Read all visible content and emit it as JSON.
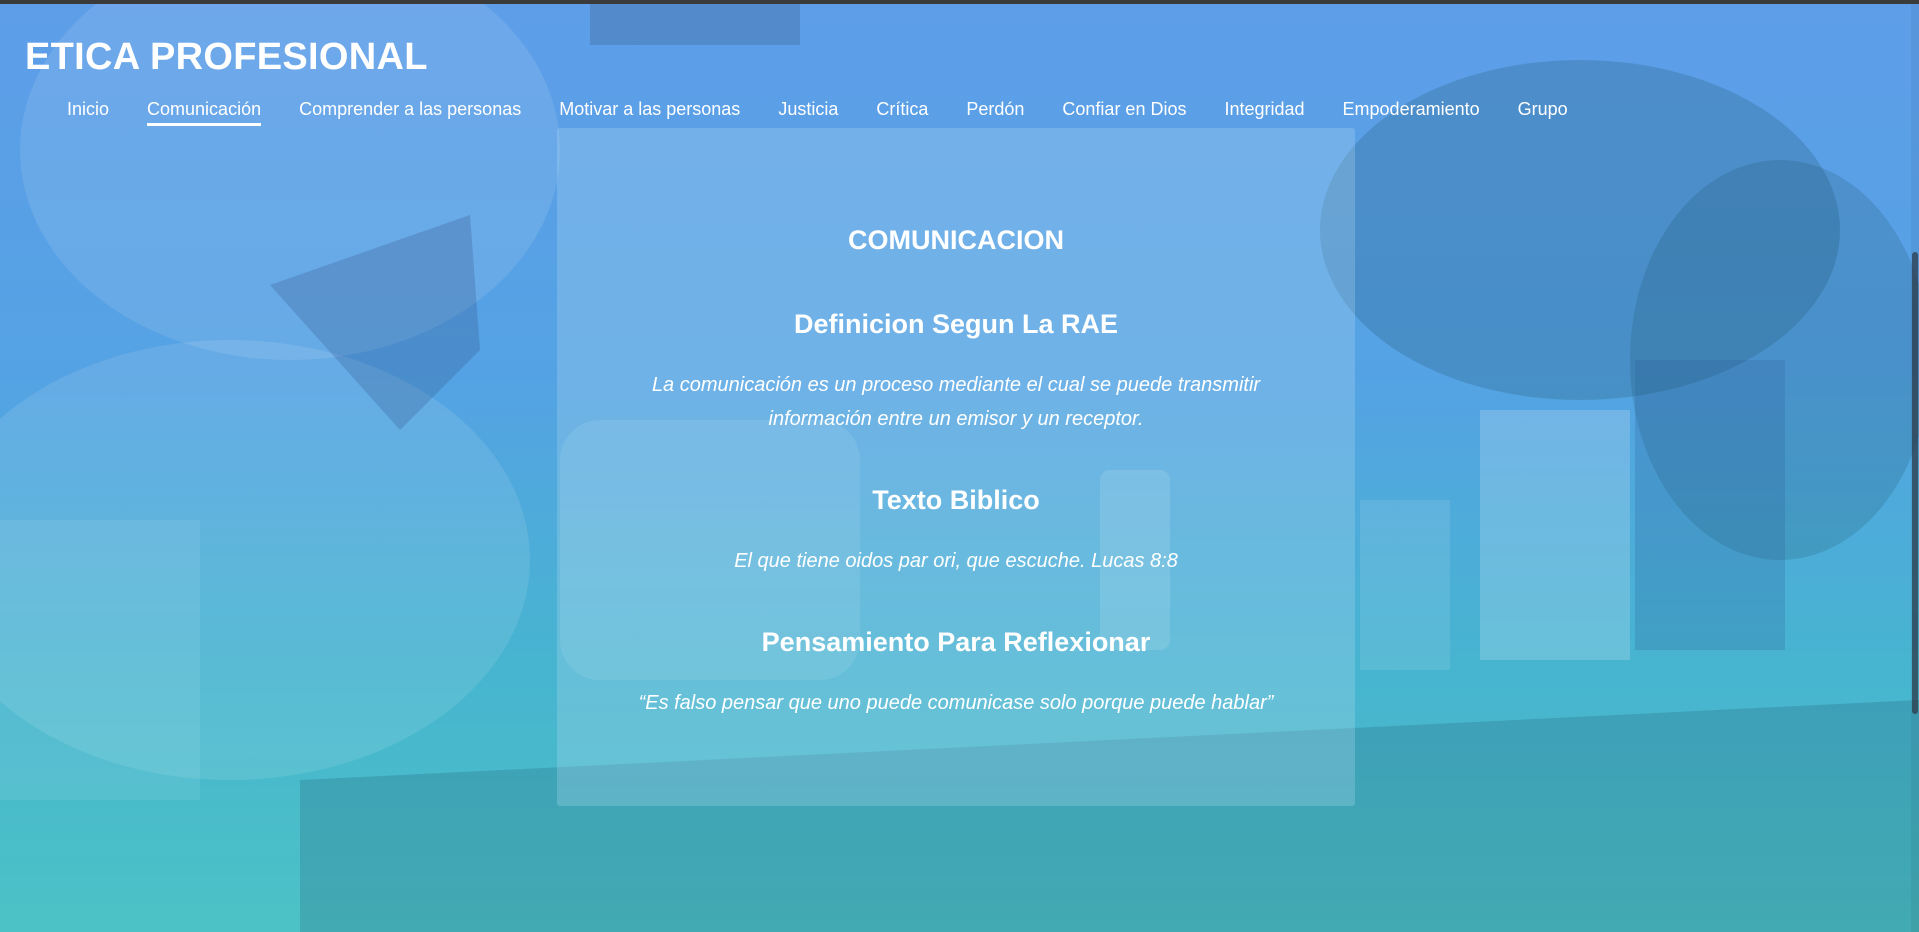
{
  "site": {
    "title": "ETICA PROFESIONAL"
  },
  "nav": {
    "items": [
      {
        "label": "Inicio"
      },
      {
        "label": "Comunicación"
      },
      {
        "label": "Comprender a las personas"
      },
      {
        "label": "Motivar a las personas"
      },
      {
        "label": "Justicia"
      },
      {
        "label": "Crítica"
      },
      {
        "label": "Perdón"
      },
      {
        "label": "Confiar en Dios"
      },
      {
        "label": "Integridad"
      },
      {
        "label": "Empoderamiento"
      },
      {
        "label": "Grupo"
      }
    ],
    "active": "Comunicación"
  },
  "content": {
    "heading": "COMUNICACION",
    "definition": {
      "title": "Definicion Segun La RAE",
      "text": "La comunicación es un proceso mediante el cual se puede transmitir información entre un emisor y un receptor."
    },
    "bible": {
      "title": "Texto Biblico",
      "text": "El que tiene oidos par ori, que escuche. Lucas 8:8"
    },
    "reflection": {
      "title": "Pensamiento Para Reflexionar",
      "text": "“Es falso pensar que uno puede comunicase solo porque puede hablar”"
    }
  },
  "colors": {
    "overlay_top": "#5e9ee9",
    "overlay_bottom": "#4bc4c4",
    "text": "#ffffff"
  }
}
